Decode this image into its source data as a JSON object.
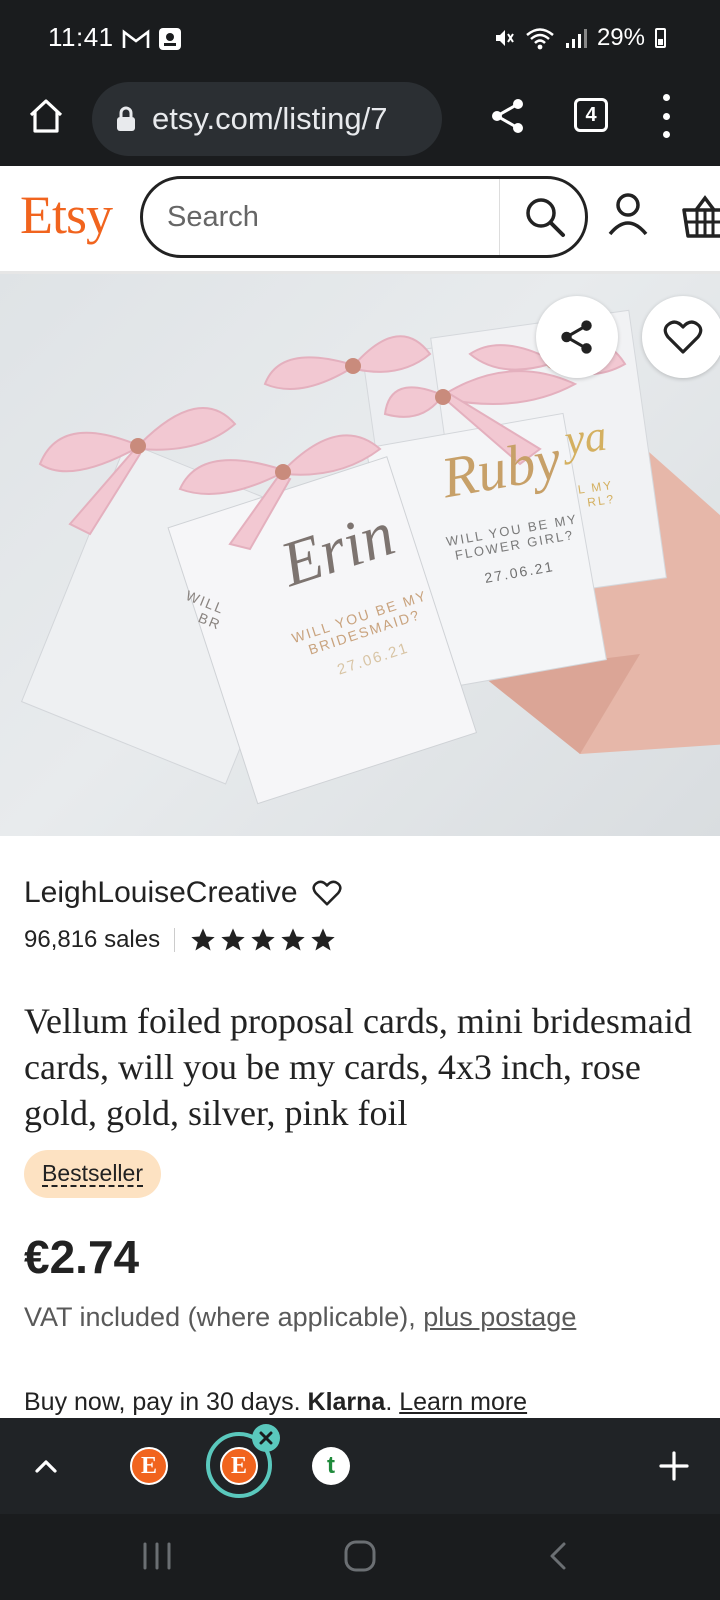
{
  "status_bar": {
    "time": "11:41",
    "battery": "29%",
    "icons": [
      "gmail-icon",
      "notification-icon",
      "mute-icon",
      "wifi-icon",
      "signal-icon",
      "battery-icon"
    ]
  },
  "browser": {
    "url": "etsy.com/listing/7",
    "tab_count": "4"
  },
  "etsy_header": {
    "logo": "Etsy",
    "search_placeholder": "Search"
  },
  "listing": {
    "shop_name": "LeighLouiseCreative",
    "sales": "96,816 sales",
    "rating_stars": 5,
    "title": "Vellum foiled proposal cards, mini bridesmaid cards, will you be my cards, 4x3 inch, rose gold, gold, silver, pink foil",
    "badge": "Bestseller",
    "price": "€2.74",
    "vat_text": "VAT included (where applicable), ",
    "postage_link": "plus postage",
    "klarna_prefix": "Buy now, pay in 30 days. ",
    "klarna_brand": "Klarna",
    "klarna_suffix": ". ",
    "learn_more": "Learn more"
  },
  "image_cards": {
    "card1_name": "Erin",
    "card1_line1": "WILL YOU BE MY",
    "card1_line2": "BRIDESMAID?",
    "card1_date": "27.06.21",
    "card2_name": "Ruby",
    "card2_line1": "WILL YOU BE MY",
    "card2_line2": "FLOWER GIRL?",
    "card2_date": "27.06.21",
    "card0_line1": "WILL",
    "card0_line2": "BR",
    "card3_name": "ya",
    "card3_line1": "L MY",
    "card3_line2": "RL?"
  },
  "tab_strip": {
    "tabs": [
      {
        "letter": "E",
        "type": "etsy"
      },
      {
        "letter": "E",
        "type": "etsy",
        "active": true
      },
      {
        "letter": "t",
        "type": "t"
      }
    ]
  },
  "colors": {
    "etsy_orange": "#f1641e",
    "badge_bg": "#fde2c2",
    "active_tab_ring": "#5ac8bd",
    "chrome_dark": "#1a1c1e"
  }
}
